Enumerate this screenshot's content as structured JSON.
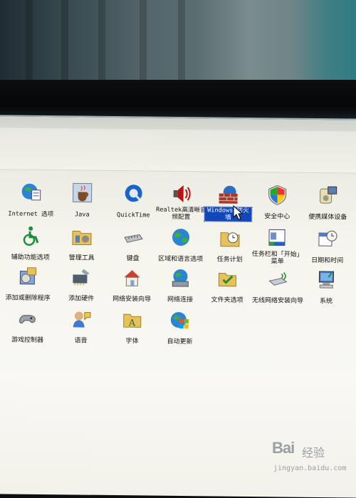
{
  "control_panel": {
    "items": [
      {
        "label": "Internet 选项",
        "icon": "internet-options-icon",
        "mono": true
      },
      {
        "label": "Java",
        "icon": "java-icon",
        "mono": true
      },
      {
        "label": "QuickTime",
        "icon": "quicktime-icon",
        "mono": true
      },
      {
        "label": "Realtek高清晰音频配置",
        "icon": "realtek-audio-icon",
        "mono": true
      },
      {
        "label": "Windows 防火墙",
        "icon": "firewall-icon",
        "mono": true,
        "selected": true
      },
      {
        "label": "安全中心",
        "icon": "security-center-icon"
      },
      {
        "label": "便携媒体设备",
        "icon": "portable-media-icon"
      },
      {
        "label": "辅助功能选项",
        "icon": "accessibility-icon"
      },
      {
        "label": "管理工具",
        "icon": "admin-tools-icon"
      },
      {
        "label": "键盘",
        "icon": "keyboard-icon"
      },
      {
        "label": "区域和语言选项",
        "icon": "region-language-icon"
      },
      {
        "label": "任务计划",
        "icon": "scheduled-tasks-icon"
      },
      {
        "label": "任务栏和「开始」菜单",
        "icon": "taskbar-start-icon"
      },
      {
        "label": "日期和时间",
        "icon": "date-time-icon"
      },
      {
        "label": "添加或删除程序",
        "icon": "add-remove-programs-icon"
      },
      {
        "label": "添加硬件",
        "icon": "add-hardware-icon"
      },
      {
        "label": "网络安装向导",
        "icon": "network-setup-icon"
      },
      {
        "label": "网络连接",
        "icon": "network-connections-icon"
      },
      {
        "label": "文件夹选项",
        "icon": "folder-options-icon"
      },
      {
        "label": "无线网络安装向导",
        "icon": "wireless-setup-icon"
      },
      {
        "label": "系统",
        "icon": "system-icon"
      },
      {
        "label": "游戏控制器",
        "icon": "game-controller-icon"
      },
      {
        "label": "语音",
        "icon": "speech-icon"
      },
      {
        "label": "字体",
        "icon": "fonts-icon"
      },
      {
        "label": "自动更新",
        "icon": "automatic-updates-icon"
      }
    ]
  },
  "watermark": {
    "brand": "Bai",
    "brand_sub": "经验",
    "url": "jingyan.baidu.com"
  },
  "colors": {
    "selection": "#1346b9",
    "screen_bg": "#f6f5ee"
  }
}
